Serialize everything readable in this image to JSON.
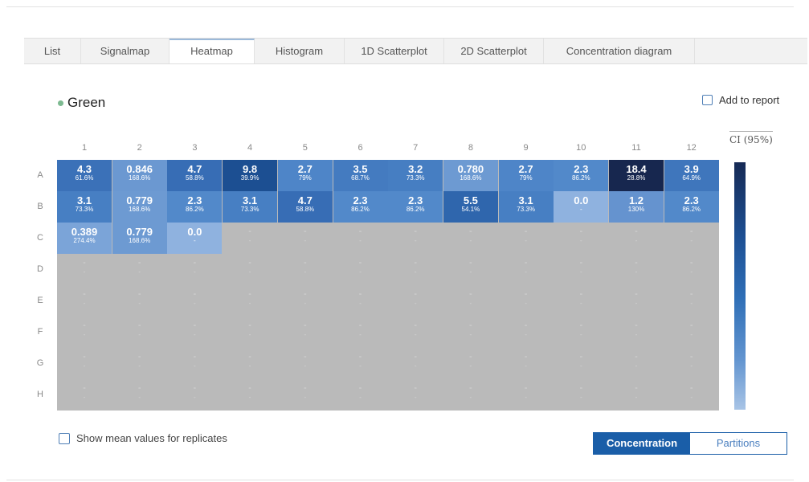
{
  "tabs": [
    "List",
    "Signalmap",
    "Heatmap",
    "Histogram",
    "1D Scatterplot",
    "2D Scatterplot",
    "Concentration diagram"
  ],
  "active_tab": "Heatmap",
  "series_label": "Green",
  "add_to_report_label": "Add to report",
  "ci_label": "CI (95%)",
  "columns": [
    "1",
    "2",
    "3",
    "4",
    "5",
    "6",
    "7",
    "8",
    "9",
    "10",
    "11",
    "12"
  ],
  "rows": [
    "A",
    "B",
    "C",
    "D",
    "E",
    "F",
    "G",
    "H"
  ],
  "empty_value": "-",
  "cells": {
    "A": [
      {
        "v": "4.3",
        "p": "61.6%",
        "c": "#3b71b8"
      },
      {
        "v": "0.846",
        "p": "168.6%",
        "c": "#6b98d1"
      },
      {
        "v": "4.7",
        "p": "58.8%",
        "c": "#376db5"
      },
      {
        "v": "9.8",
        "p": "39.9%",
        "c": "#1c4f92"
      },
      {
        "v": "2.7",
        "p": "79%",
        "c": "#4e85c8"
      },
      {
        "v": "3.5",
        "p": "68.7%",
        "c": "#447bc0"
      },
      {
        "v": "3.2",
        "p": "73.3%",
        "c": "#467ec2"
      },
      {
        "v": "0.780",
        "p": "168.6%",
        "c": "#6d9ad2"
      },
      {
        "v": "2.7",
        "p": "79%",
        "c": "#4e85c8"
      },
      {
        "v": "2.3",
        "p": "86.2%",
        "c": "#5289ca"
      },
      {
        "v": "18.4",
        "p": "28.8%",
        "c": "#17274f"
      },
      {
        "v": "3.9",
        "p": "64.9%",
        "c": "#3f76bc"
      }
    ],
    "B": [
      {
        "v": "3.1",
        "p": "73.3%",
        "c": "#477fc3"
      },
      {
        "v": "0.779",
        "p": "168.6%",
        "c": "#6d9ad2"
      },
      {
        "v": "2.3",
        "p": "86.2%",
        "c": "#5289ca"
      },
      {
        "v": "3.1",
        "p": "73.3%",
        "c": "#477fc3"
      },
      {
        "v": "4.7",
        "p": "58.8%",
        "c": "#376db5"
      },
      {
        "v": "2.3",
        "p": "86.2%",
        "c": "#5289ca"
      },
      {
        "v": "2.3",
        "p": "86.2%",
        "c": "#5289ca"
      },
      {
        "v": "5.5",
        "p": "54.1%",
        "c": "#2f66ad"
      },
      {
        "v": "3.1",
        "p": "73.3%",
        "c": "#477fc3"
      },
      {
        "v": "0.0",
        "p": "-",
        "c": "#8fb2df"
      },
      {
        "v": "1.2",
        "p": "130%",
        "c": "#6593cf"
      },
      {
        "v": "2.3",
        "p": "86.2%",
        "c": "#5289ca"
      }
    ],
    "C": [
      {
        "v": "0.389",
        "p": "274.4%",
        "c": "#7ba4d8"
      },
      {
        "v": "0.779",
        "p": "168.6%",
        "c": "#6d9ad2"
      },
      {
        "v": "0.0",
        "p": "-",
        "c": "#8fb2df"
      }
    ]
  },
  "show_mean_label": "Show mean values for replicates",
  "toggle": {
    "concentration": "Concentration",
    "partitions": "Partitions"
  },
  "colors": {
    "accent": "#1a5ea8",
    "empty_cell": "#bababa",
    "legend_dark": "#162a55",
    "legend_light": "#a8c4e6"
  }
}
